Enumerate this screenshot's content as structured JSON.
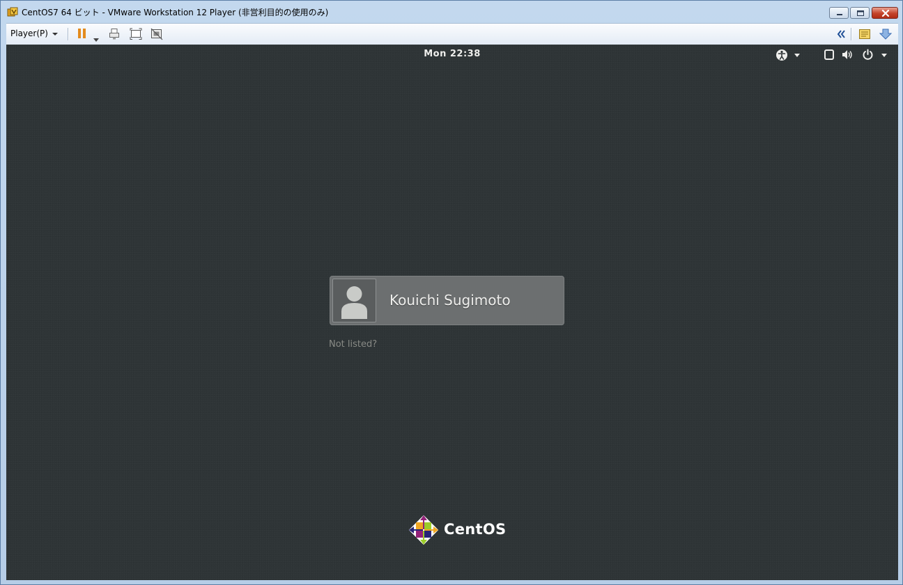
{
  "window": {
    "title": "CentOS7 64 ビット - VMware Workstation 12 Player (非営利目的の使用のみ)",
    "icon": "vmware-player-icon",
    "controls": [
      "minimize-icon",
      "maximize-icon",
      "close-icon"
    ]
  },
  "toolbar": {
    "player_menu_label": "Player(P)",
    "left_icons": [
      "pause-icon",
      "dropdown-caret",
      "send-ctrl-alt-del-icon",
      "fit-guest-icon",
      "unity-icon"
    ],
    "right_icons": [
      "collapse-double-chevron-icon",
      "notes-icon",
      "download-arrow-icon"
    ],
    "accent_colors": {
      "pause": "#e38b1d",
      "download": "#5b8fd1"
    }
  },
  "guest": {
    "clock": "Mon 22:38",
    "top_right_icons": [
      "accessibility-icon",
      "window-icon",
      "volume-icon",
      "power-icon"
    ],
    "user": {
      "name": "Kouichi Sugimoto",
      "avatar": "default-user-avatar-icon"
    },
    "not_listed_label": "Not listed?",
    "brand_name": "CentOS",
    "background_color": "#2e3436"
  }
}
